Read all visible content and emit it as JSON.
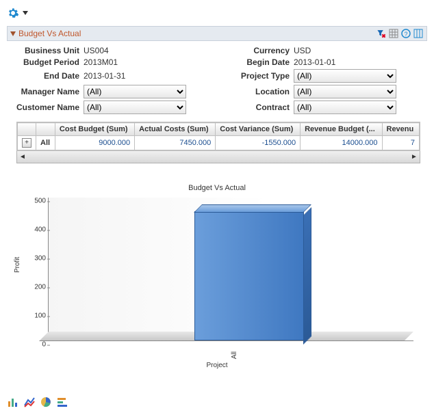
{
  "section": {
    "title": "Budget Vs Actual"
  },
  "filters": {
    "business_unit": {
      "label": "Business Unit",
      "value": "US004"
    },
    "currency": {
      "label": "Currency",
      "value": "USD"
    },
    "budget_period": {
      "label": "Budget Period",
      "value": "2013M01"
    },
    "begin_date": {
      "label": "Begin Date",
      "value": "2013-01-01"
    },
    "end_date": {
      "label": "End Date",
      "value": "2013-01-31"
    },
    "project_type": {
      "label": "Project Type",
      "value": "(All)"
    },
    "manager_name": {
      "label": "Manager Name",
      "value": "(All)"
    },
    "location": {
      "label": "Location",
      "value": "(All)"
    },
    "customer_name": {
      "label": "Customer Name",
      "value": "(All)"
    },
    "contract": {
      "label": "Contract",
      "value": "(All)"
    }
  },
  "table": {
    "columns": [
      "",
      "Cost Budget (Sum)",
      "Actual Costs (Sum)",
      "Cost Variance (Sum)",
      "Revenue Budget (...",
      "Revenu"
    ],
    "rows": [
      {
        "label": "All",
        "cost_budget": "9000.000",
        "actual_costs": "7450.000",
        "cost_variance": "-1550.000",
        "revenue_budget": "14000.000",
        "revenue": "7"
      }
    ]
  },
  "chart_data": {
    "type": "bar",
    "title": "Budget Vs Actual",
    "xlabel": "Project",
    "ylabel": "Profit",
    "categories": [
      "All"
    ],
    "values": [
      450
    ],
    "ylim": [
      0,
      500
    ],
    "yticks": [
      0,
      100,
      200,
      300,
      400,
      500
    ]
  }
}
